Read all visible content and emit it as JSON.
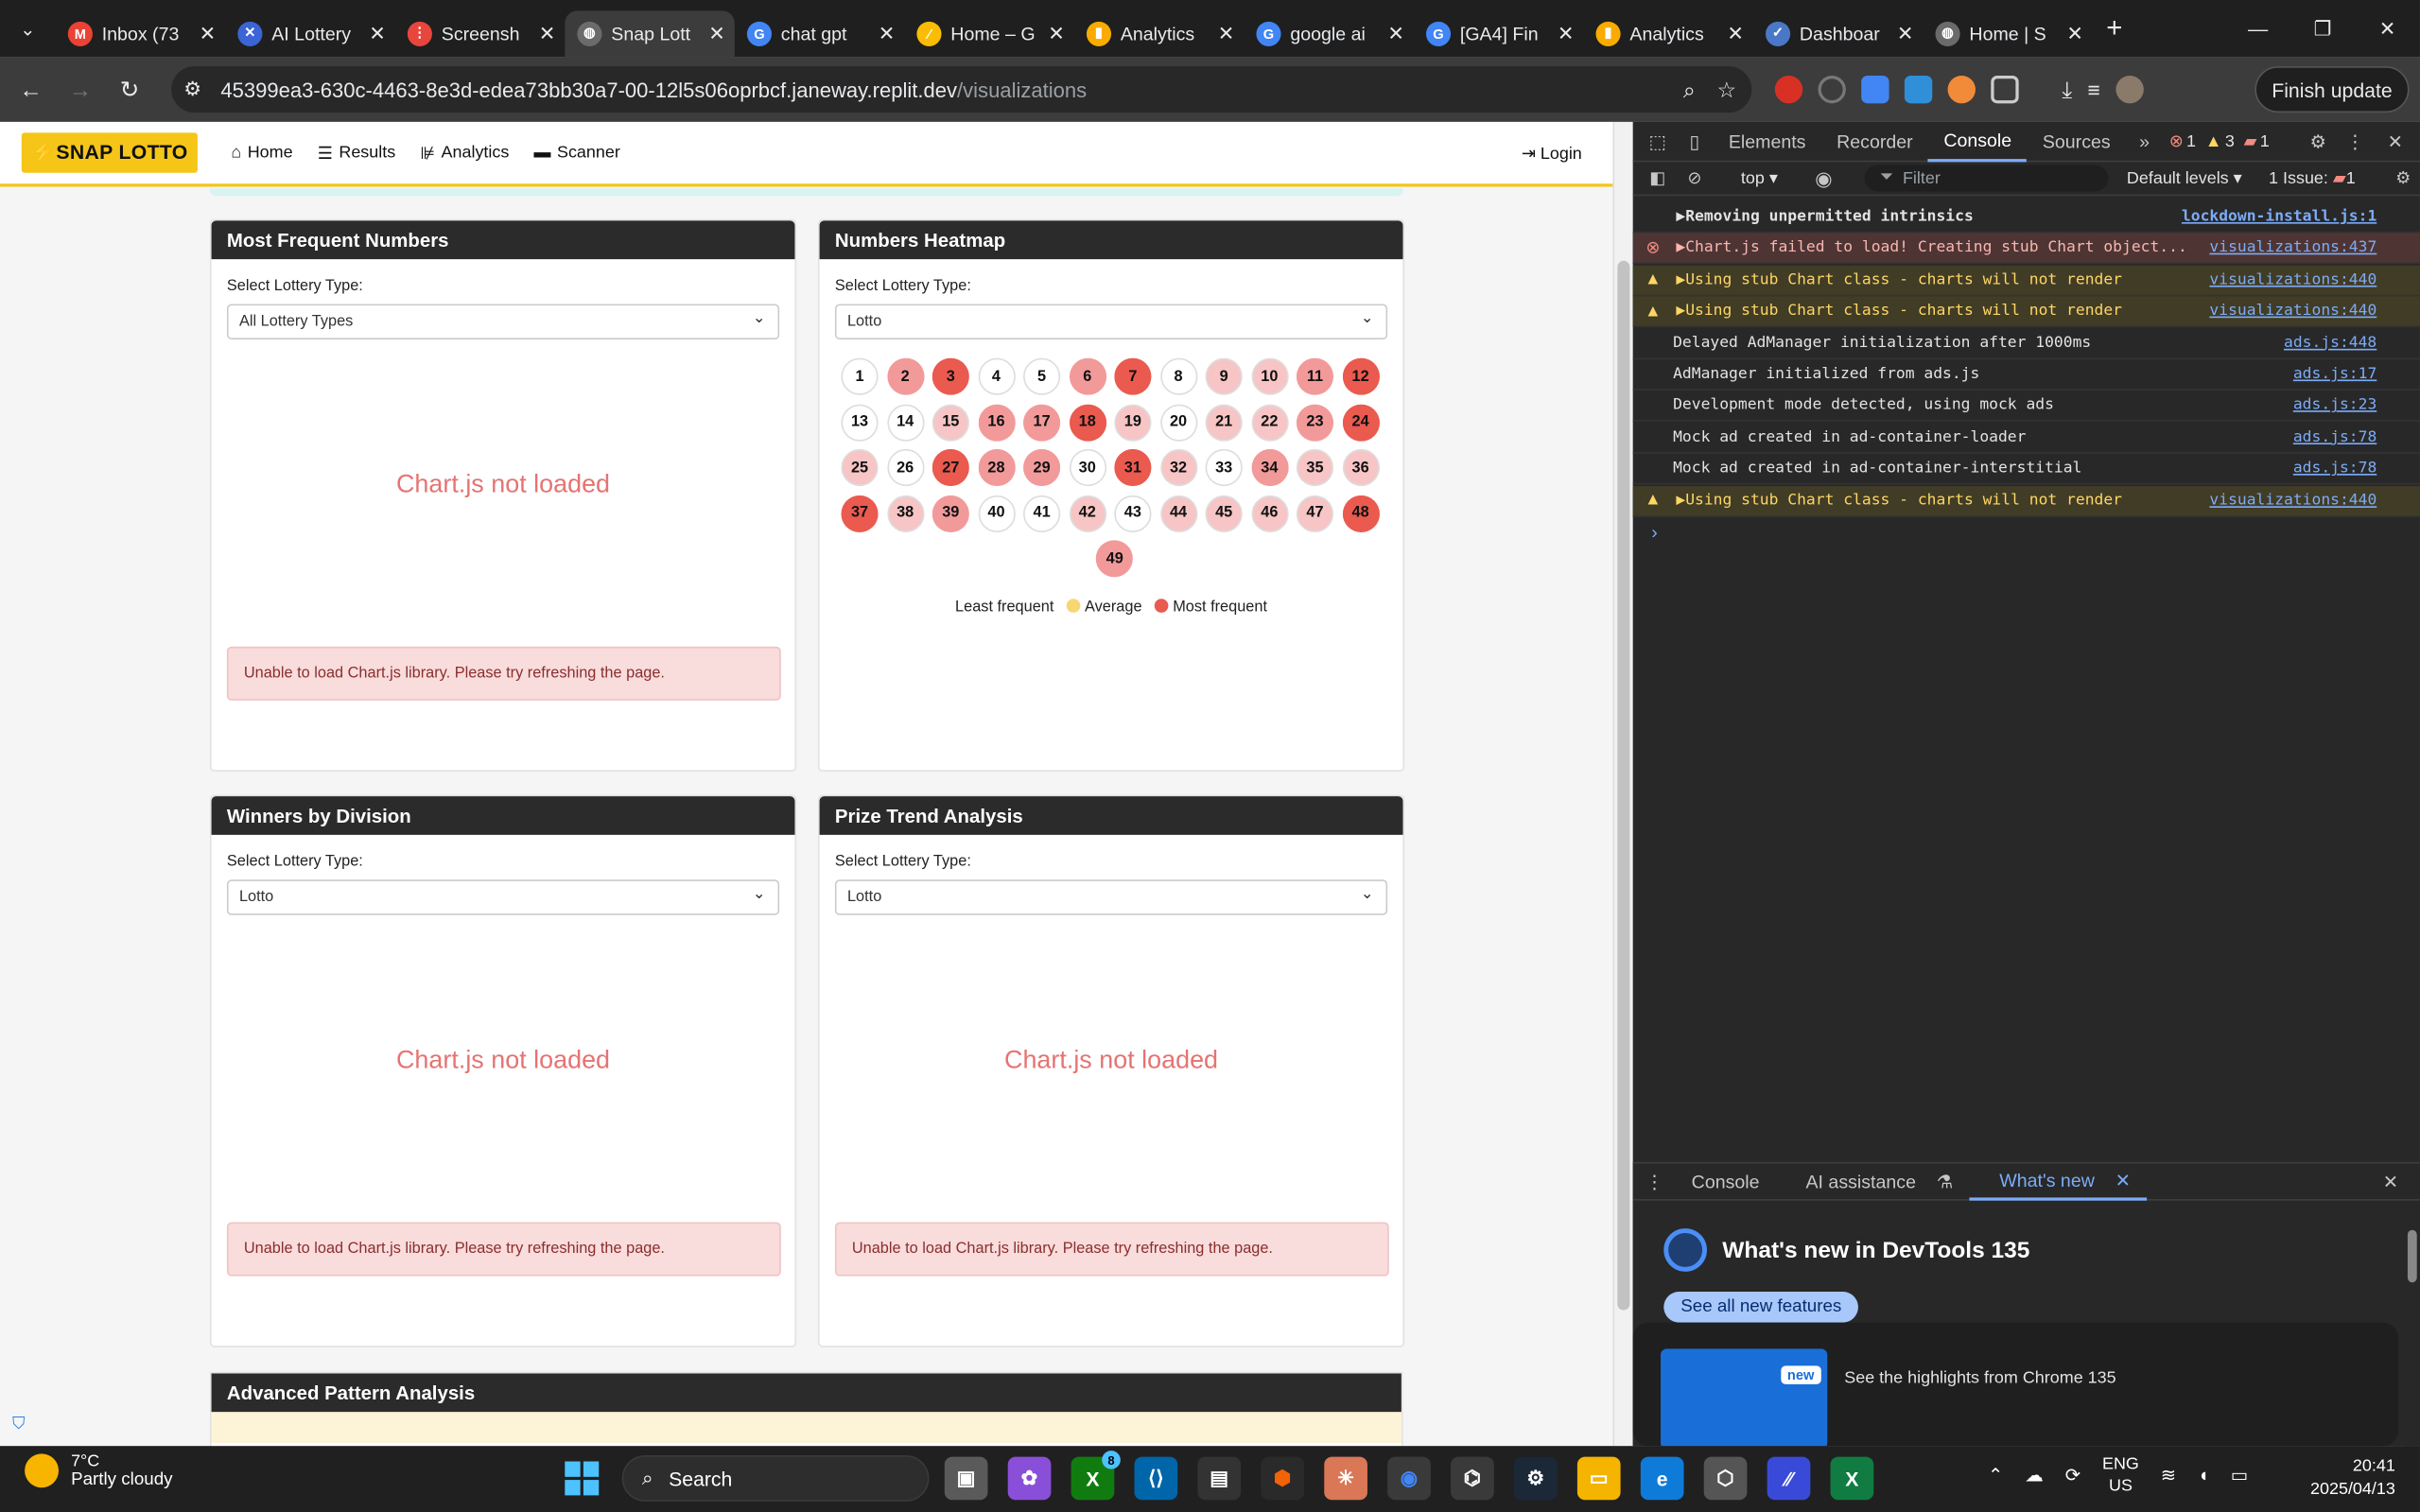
{
  "browser": {
    "tabs": [
      {
        "title": "Inbox (73",
        "color": "#ea4335",
        "glyph": "M"
      },
      {
        "title": "AI Lottery",
        "color": "#3b64d6",
        "glyph": "✕"
      },
      {
        "title": "Screensh",
        "color": "#e8453c",
        "glyph": "⋮"
      },
      {
        "title": "Snap Lott",
        "color": "#6b6b6b",
        "glyph": "◍"
      },
      {
        "title": "chat gpt",
        "color": "#4285f4",
        "glyph": "G"
      },
      {
        "title": "Home – G",
        "color": "#fbbc04",
        "glyph": "⁄"
      },
      {
        "title": "Analytics",
        "color": "#f9ab00",
        "glyph": "▮"
      },
      {
        "title": "google ai",
        "color": "#4285f4",
        "glyph": "G"
      },
      {
        "title": "[GA4] Fin",
        "color": "#4285f4",
        "glyph": "G"
      },
      {
        "title": "Analytics",
        "color": "#f9ab00",
        "glyph": "▮"
      },
      {
        "title": "Dashboar",
        "color": "#4a78c7",
        "glyph": "✓"
      },
      {
        "title": "Home | S",
        "color": "#6b6b6b",
        "glyph": "◍"
      }
    ],
    "active_tab": 3,
    "url_host": "45399ea3-630c-4463-8e3d-edea73bb30a7-00-12l5s06oprbcf.janeway.replit.dev",
    "url_path": "/visualizations",
    "finish_update": "Finish update"
  },
  "site": {
    "brand": "⚡SNAP LOTTO",
    "nav": [
      {
        "icon": "⌂",
        "label": "Home"
      },
      {
        "icon": "☰",
        "label": "Results"
      },
      {
        "icon": "⊯",
        "label": "Analytics"
      },
      {
        "icon": "▬",
        "label": "Scanner"
      }
    ],
    "login": "Login",
    "select_label": "Select Lottery Type:",
    "not_loaded": "Chart.js not loaded",
    "error_msg": "Unable to load Chart.js library. Please try refreshing the page.",
    "cards": {
      "frequent": {
        "title": "Most Frequent Numbers",
        "selected": "All Lottery Types"
      },
      "heatmap": {
        "title": "Numbers Heatmap",
        "selected": "Lotto"
      },
      "winners": {
        "title": "Winners by Division",
        "selected": "Lotto"
      },
      "prize": {
        "title": "Prize Trend Analysis",
        "selected": "Lotto"
      }
    },
    "advanced_title": "Advanced Pattern Analysis",
    "legend": {
      "least": "Least frequent",
      "average": "Average",
      "most": "Most frequent"
    },
    "heat_colors": [
      "#ffffff",
      "#f7c5c5",
      "#f29a9a",
      "#ea5a4f"
    ],
    "heatmap": [
      {
        "n": 1,
        "level": 0
      },
      {
        "n": 2,
        "level": 2
      },
      {
        "n": 3,
        "level": 3
      },
      {
        "n": 4,
        "level": 0
      },
      {
        "n": 5,
        "level": 0
      },
      {
        "n": 6,
        "level": 2
      },
      {
        "n": 7,
        "level": 3
      },
      {
        "n": 8,
        "level": 0
      },
      {
        "n": 9,
        "level": 1
      },
      {
        "n": 10,
        "level": 1
      },
      {
        "n": 11,
        "level": 2
      },
      {
        "n": 12,
        "level": 3
      },
      {
        "n": 13,
        "level": 0
      },
      {
        "n": 14,
        "level": 0
      },
      {
        "n": 15,
        "level": 1
      },
      {
        "n": 16,
        "level": 2
      },
      {
        "n": 17,
        "level": 2
      },
      {
        "n": 18,
        "level": 3
      },
      {
        "n": 19,
        "level": 1
      },
      {
        "n": 20,
        "level": 0
      },
      {
        "n": 21,
        "level": 1
      },
      {
        "n": 22,
        "level": 1
      },
      {
        "n": 23,
        "level": 2
      },
      {
        "n": 24,
        "level": 3
      },
      {
        "n": 25,
        "level": 1
      },
      {
        "n": 26,
        "level": 0
      },
      {
        "n": 27,
        "level": 3
      },
      {
        "n": 28,
        "level": 2
      },
      {
        "n": 29,
        "level": 2
      },
      {
        "n": 30,
        "level": 0
      },
      {
        "n": 31,
        "level": 3
      },
      {
        "n": 32,
        "level": 1
      },
      {
        "n": 33,
        "level": 0
      },
      {
        "n": 34,
        "level": 2
      },
      {
        "n": 35,
        "level": 1
      },
      {
        "n": 36,
        "level": 1
      },
      {
        "n": 37,
        "level": 3
      },
      {
        "n": 38,
        "level": 1
      },
      {
        "n": 39,
        "level": 2
      },
      {
        "n": 40,
        "level": 0
      },
      {
        "n": 41,
        "level": 0
      },
      {
        "n": 42,
        "level": 1
      },
      {
        "n": 43,
        "level": 0
      },
      {
        "n": 44,
        "level": 1
      },
      {
        "n": 45,
        "level": 1
      },
      {
        "n": 46,
        "level": 1
      },
      {
        "n": 47,
        "level": 1
      },
      {
        "n": 48,
        "level": 3
      },
      {
        "n": 49,
        "level": 2
      }
    ]
  },
  "devtools": {
    "tabs": [
      "Elements",
      "Recorder",
      "Console",
      "Sources"
    ],
    "active": "Console",
    "errors": "1",
    "warnings": "3",
    "messages": "1",
    "context": "top",
    "filter_placeholder": "Filter",
    "levels": "Default levels",
    "issues": "1 Issue:",
    "issue_count": "1",
    "logs": [
      {
        "type": "info",
        "expand": "▶",
        "msg": "Removing unpermitted intrinsics",
        "src": "lockdown-install.js:1",
        "bold": true
      },
      {
        "type": "err",
        "expand": "▶",
        "msg": "Chart.js failed to load! Creating stub Chart object...",
        "src": "visualizations:437"
      },
      {
        "type": "warn",
        "expand": "▶",
        "msg": "Using stub Chart class - charts will not render",
        "src": "visualizations:440"
      },
      {
        "type": "warn",
        "expand": "▶",
        "msg": "Using stub Chart class - charts will not render",
        "src": "visualizations:440"
      },
      {
        "type": "log",
        "expand": "",
        "msg": "Delayed AdManager initialization after 1000ms",
        "src": "ads.js:448"
      },
      {
        "type": "log",
        "expand": "",
        "msg": "AdManager initialized from ads.js",
        "src": "ads.js:17"
      },
      {
        "type": "log",
        "expand": "",
        "msg": "Development mode detected, using mock ads",
        "src": "ads.js:23"
      },
      {
        "type": "log",
        "expand": "",
        "msg": "Mock ad created in ad-container-loader",
        "src": "ads.js:78"
      },
      {
        "type": "log",
        "expand": "",
        "msg": "Mock ad created in ad-container-interstitial",
        "src": "ads.js:78"
      },
      {
        "type": "warn",
        "expand": "▶",
        "msg": "Using stub Chart class - charts will not render",
        "src": "visualizations:440"
      }
    ],
    "drawer_tabs": [
      "Console",
      "AI assistance",
      "What's new"
    ],
    "whats_new_title": "What's new in DevTools 135",
    "see_all": "See all new features",
    "highlight": "See the highlights from Chrome 135",
    "new_badge": "new"
  },
  "taskbar": {
    "temp": "7°C",
    "weather": "Partly cloudy",
    "search": "Search",
    "lang1": "ENG",
    "lang2": "US",
    "time": "20:41",
    "date": "2025/04/13",
    "badge": "8"
  }
}
